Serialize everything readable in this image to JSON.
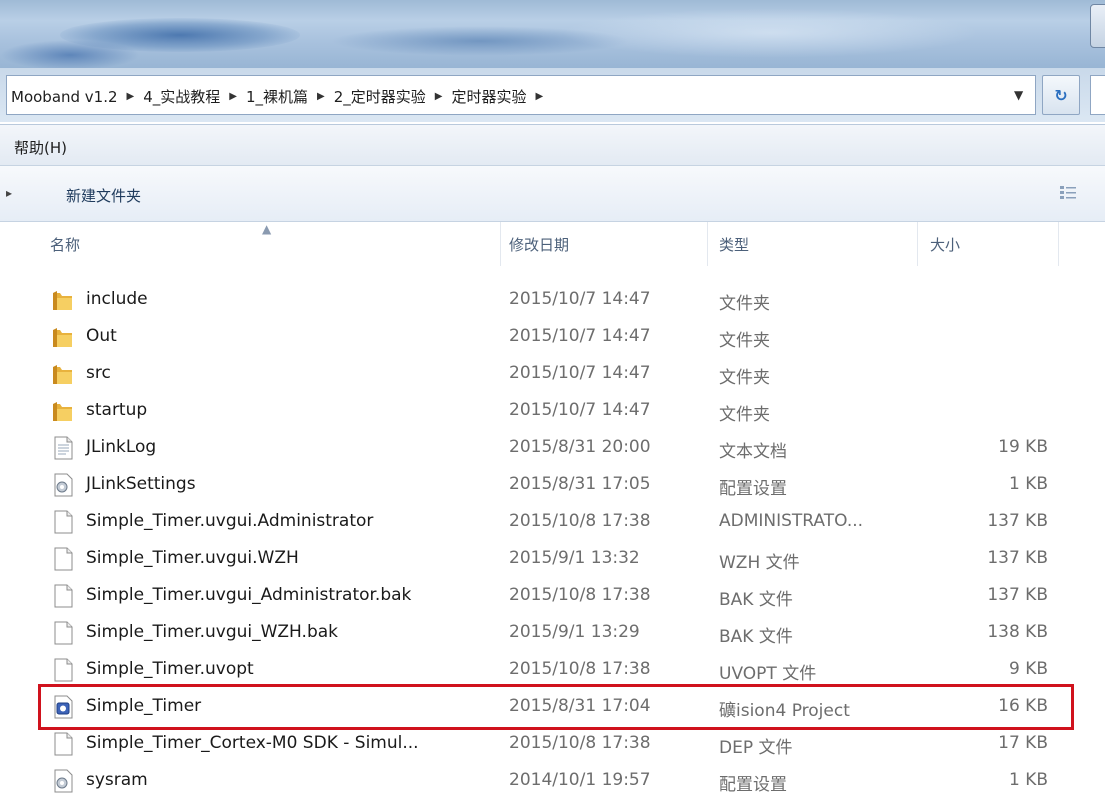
{
  "breadcrumb": [
    "Mooband v1.2",
    "4_实战教程",
    "1_裸机篇",
    "2_定时器实验",
    "定时器实验"
  ],
  "menu": {
    "help": "帮助(H)"
  },
  "toolbar": {
    "new_folder": "新建文件夹"
  },
  "columns": {
    "name": "名称",
    "date": "修改日期",
    "type": "类型",
    "size": "大小"
  },
  "highlight_color": "#d0121d",
  "files": [
    {
      "name": "include",
      "date": "2015/10/7 14:47",
      "type": "文件夹",
      "size": "",
      "icon": "folder-icon"
    },
    {
      "name": "Out",
      "date": "2015/10/7 14:47",
      "type": "文件夹",
      "size": "",
      "icon": "folder-icon"
    },
    {
      "name": "src",
      "date": "2015/10/7 14:47",
      "type": "文件夹",
      "size": "",
      "icon": "folder-icon"
    },
    {
      "name": "startup",
      "date": "2015/10/7 14:47",
      "type": "文件夹",
      "size": "",
      "icon": "folder-icon"
    },
    {
      "name": "JLinkLog",
      "date": "2015/8/31 20:00",
      "type": "文本文档",
      "size": "19 KB",
      "icon": "text-file-icon"
    },
    {
      "name": "JLinkSettings",
      "date": "2015/8/31 17:05",
      "type": "配置设置",
      "size": "1 KB",
      "icon": "settings-file-icon"
    },
    {
      "name": "Simple_Timer.uvgui.Administrator",
      "date": "2015/10/8 17:38",
      "type": "ADMINISTRATO...",
      "size": "137 KB",
      "icon": "blank-file-icon"
    },
    {
      "name": "Simple_Timer.uvgui.WZH",
      "date": "2015/9/1 13:32",
      "type": "WZH 文件",
      "size": "137 KB",
      "icon": "blank-file-icon"
    },
    {
      "name": "Simple_Timer.uvgui_Administrator.bak",
      "date": "2015/10/8 17:38",
      "type": "BAK 文件",
      "size": "137 KB",
      "icon": "blank-file-icon"
    },
    {
      "name": "Simple_Timer.uvgui_WZH.bak",
      "date": "2015/9/1 13:29",
      "type": "BAK 文件",
      "size": "138 KB",
      "icon": "blank-file-icon"
    },
    {
      "name": "Simple_Timer.uvopt",
      "date": "2015/10/8 17:38",
      "type": "UVOPT 文件",
      "size": "9 KB",
      "icon": "blank-file-icon"
    },
    {
      "name": "Simple_Timer",
      "date": "2015/8/31 17:04",
      "type": "礦ision4 Project",
      "size": "16 KB",
      "icon": "uvision-project-icon",
      "highlighted": true
    },
    {
      "name": "Simple_Timer_Cortex-M0 SDK - Simul...",
      "date": "2015/10/8 17:38",
      "type": "DEP 文件",
      "size": "17 KB",
      "icon": "blank-file-icon"
    },
    {
      "name": "sysram",
      "date": "2014/10/1 19:57",
      "type": "配置设置",
      "size": "1 KB",
      "icon": "settings-file-icon"
    }
  ]
}
